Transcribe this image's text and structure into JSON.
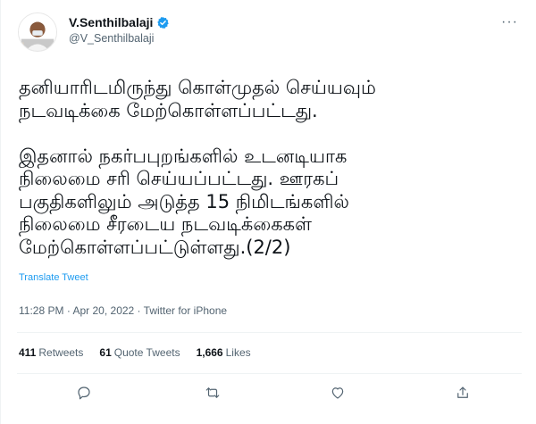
{
  "author": {
    "name": "V.Senthilbalaji",
    "handle": "@V_Senthilbalaji",
    "verified_icon": "verified-badge-icon",
    "accent_color": "#1d9bf0"
  },
  "more_label": "···",
  "tweet": {
    "text": "தனியாரிடமிருந்து கொள்முதல் செய்யவும்\nநடவடிக்கை மேற்கொள்ளப்பட்டது.\n\nஇதனால் நகர்பபுறங்களில் உடனடியாக\nநிலைமை சரி செய்யப்பட்டது. ஊரகப்\nபகுதிகளிலும் அடுத்த 15 நிமிடங்களில்\nநிலைமை சீரடைய நடவடிக்கைகள்\nமேற்கொள்ளப்பட்டுள்ளது.(2/2)",
    "translate_label": "Translate Tweet",
    "time": "11:28 PM",
    "separator": " · ",
    "date": "Apr 20, 2022",
    "source": "Twitter for iPhone"
  },
  "stats": {
    "retweets_count": "411",
    "retweets_label": "Retweets",
    "quotes_count": "61",
    "quotes_label": "Quote Tweets",
    "likes_count": "1,666",
    "likes_label": "Likes"
  },
  "actions": [
    "reply-icon",
    "retweet-icon",
    "like-icon",
    "share-icon"
  ]
}
